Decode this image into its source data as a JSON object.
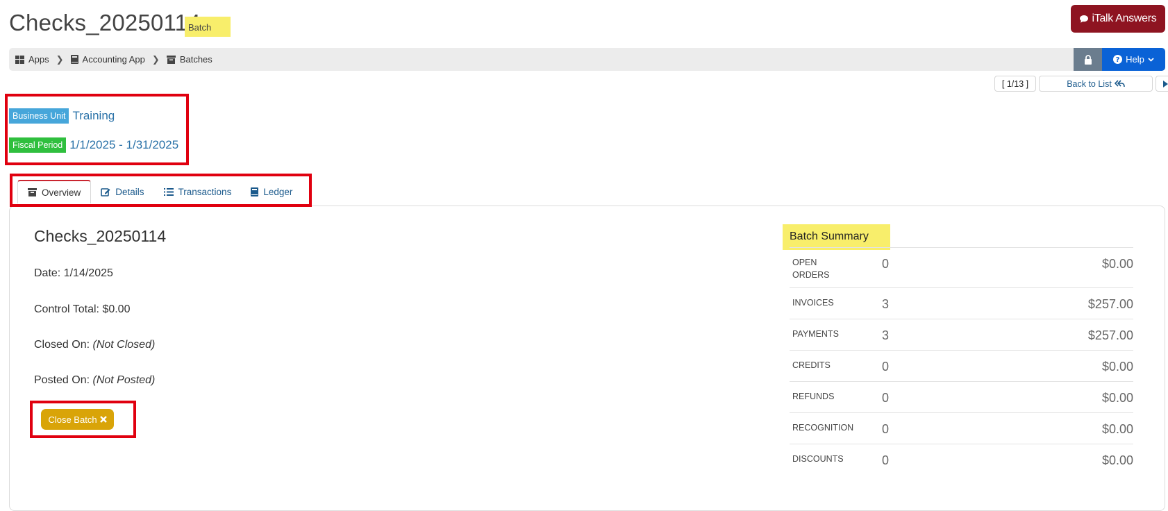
{
  "header": {
    "title": "Checks_20250114",
    "title_badge": "Batch",
    "italk_label": "iTalk Answers"
  },
  "breadcrumb": {
    "items": [
      {
        "label": "Apps",
        "icon": "grid-icon"
      },
      {
        "label": "Accounting App",
        "icon": "book-icon"
      },
      {
        "label": "Batches",
        "icon": "archive-icon"
      }
    ],
    "help_label": "Help"
  },
  "record_nav": {
    "position": "[ 1/13 ]",
    "back_label": "Back to List"
  },
  "info": {
    "business_unit_label": "Business Unit",
    "business_unit_value": "Training",
    "fiscal_period_label": "Fiscal Period",
    "fiscal_period_value": "1/1/2025 - 1/31/2025"
  },
  "tabs": [
    {
      "label": "Overview",
      "icon": "archive-icon",
      "active": true
    },
    {
      "label": "Details",
      "icon": "edit-icon",
      "active": false
    },
    {
      "label": "Transactions",
      "icon": "list-icon",
      "active": false
    },
    {
      "label": "Ledger",
      "icon": "book-icon",
      "active": false
    }
  ],
  "overview": {
    "batch_name": "Checks_20250114",
    "date_label": "Date:",
    "date_value": "1/14/2025",
    "control_total_label": "Control Total:",
    "control_total_value": "$0.00",
    "closed_on_label": "Closed On:",
    "closed_on_value": "(Not Closed)",
    "posted_on_label": "Posted On:",
    "posted_on_value": "(Not Posted)",
    "close_batch_label": "Close Batch"
  },
  "summary": {
    "title": "Batch Summary",
    "rows": [
      {
        "label": "OPEN ORDERS",
        "count": "0",
        "amount": "$0.00"
      },
      {
        "label": "INVOICES",
        "count": "3",
        "amount": "$257.00"
      },
      {
        "label": "PAYMENTS",
        "count": "3",
        "amount": "$257.00"
      },
      {
        "label": "CREDITS",
        "count": "0",
        "amount": "$0.00"
      },
      {
        "label": "REFUNDS",
        "count": "0",
        "amount": "$0.00"
      },
      {
        "label": "RECOGNITION",
        "count": "0",
        "amount": "$0.00"
      },
      {
        "label": "DISCOUNTS",
        "count": "0",
        "amount": "$0.00"
      }
    ]
  },
  "colors": {
    "italk": "#8e1421",
    "help": "#0a62d6",
    "highlight": "#f8ee6b",
    "annotation": "#e0000f",
    "business_unit": "#46a6da",
    "fiscal_period": "#2fbf3e",
    "close_batch": "#d9a408"
  }
}
